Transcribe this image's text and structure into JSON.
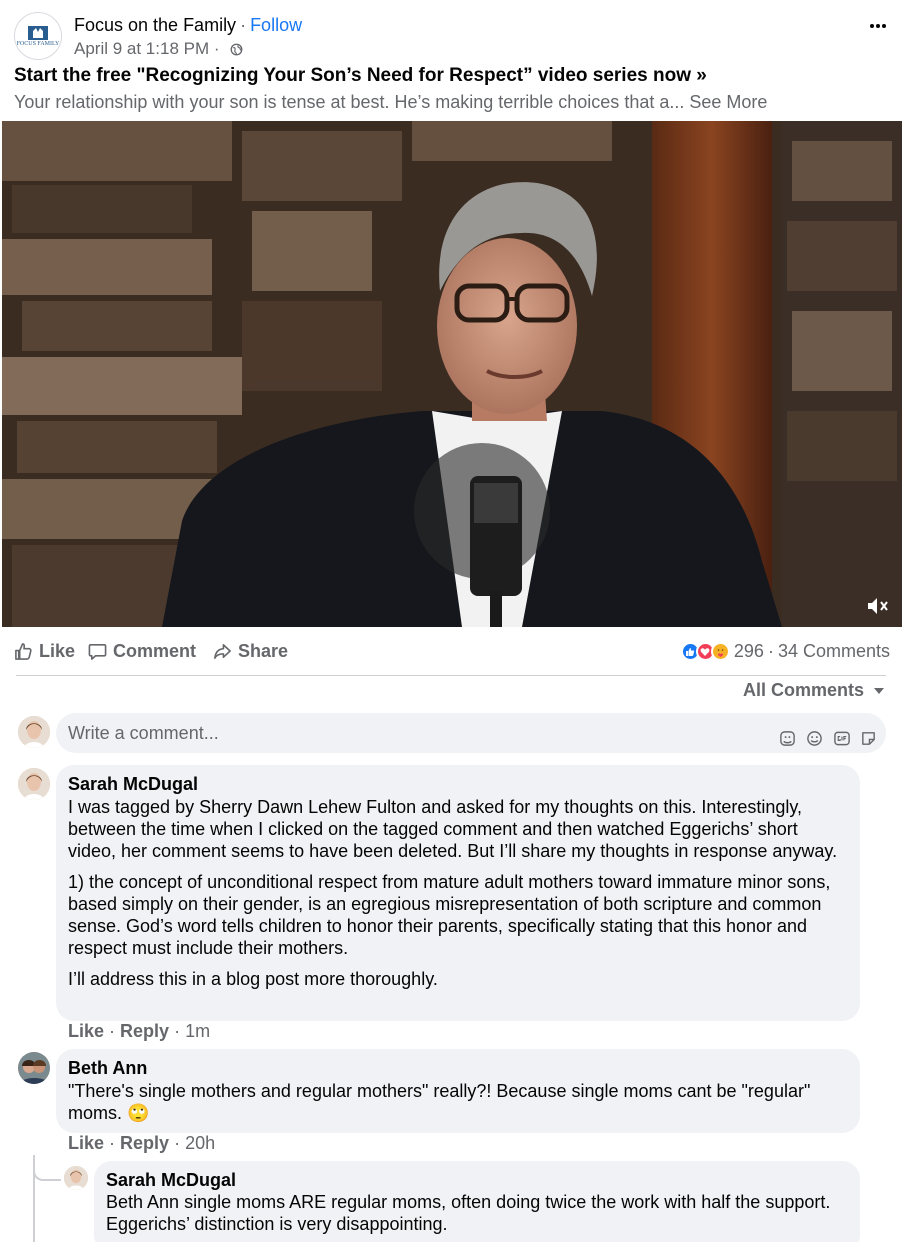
{
  "post": {
    "page_name": "Focus on the Family",
    "separator": "·",
    "follow_label": "Follow",
    "timestamp": "April 9 at 1:18 PM",
    "meta_separator": " · ",
    "logo_text": "FOCUS FAMILY",
    "headline": "Start the free \"Recognizing Your Son’s Need for Respect” video series now »",
    "subtitle": "Your relationship with your son is tense at best. He’s making terrible choices that a...",
    "see_more": "See More",
    "more_icon": "more-horizontal-icon"
  },
  "actions": {
    "like_label": "Like",
    "comment_label": "Comment",
    "share_label": "Share",
    "reaction_count": "296",
    "comments_separator": "·",
    "comments_count": "34 Comments",
    "reaction_icons": [
      "like-reaction-icon",
      "love-reaction-icon",
      "care-reaction-icon"
    ]
  },
  "comments_section": {
    "filter_label": "All Comments",
    "composer_placeholder": "Write a comment...",
    "composer_icons": [
      "avatar-sticker-icon",
      "emoji-icon",
      "gif-icon",
      "sticker-icon"
    ],
    "comments": [
      {
        "author": "Sarah McDugal",
        "paragraphs": [
          "I was tagged by Sherry Dawn Lehew Fulton and asked for my thoughts on this. Interestingly, between the time when I clicked on the tagged comment and then watched Eggerichs’ short video, her comment seems to have been deleted. But I’ll share my thoughts in response anyway.",
          "1) the concept of unconditional respect from mature adult mothers toward immature minor sons, based simply on their gender, is an egregious misrepresentation of both scripture and common sense. God’s word tells children to honor their parents, specifically stating that this honor and respect must include their mothers.",
          "I’ll address this in a blog post more thoroughly."
        ],
        "like_label": "Like",
        "reply_label": "Reply",
        "time": "1m"
      },
      {
        "author": "Beth Ann",
        "paragraphs": [
          "\"There's single mothers and regular mothers\" really?! Because single moms cant be \"regular\" moms. 🙄"
        ],
        "like_label": "Like",
        "reply_label": "Reply",
        "time": "20h"
      }
    ],
    "reply": {
      "author": "Sarah McDugal",
      "text": "Beth Ann single moms ARE regular moms, often doing twice the work with half the support. Eggerichs’ distinction is very disappointing."
    }
  },
  "colors": {
    "link_blue": "#1877f2",
    "secondary_text": "#65676b",
    "bubble_bg": "#f0f2f5"
  }
}
